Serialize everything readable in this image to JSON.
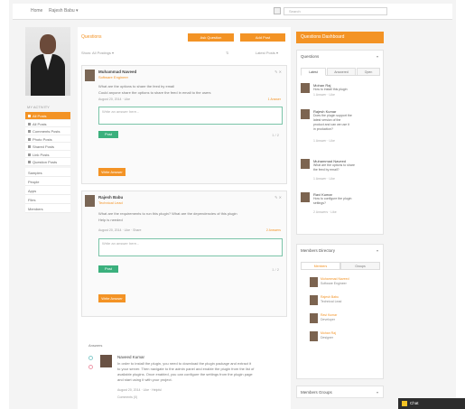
{
  "topbar": {
    "home_link": "Home",
    "user_menu": "Rajesh Babu ▾",
    "search_placeholder": "Search"
  },
  "profile": {
    "section_label": "MY ACTIVITY"
  },
  "nav": {
    "items": [
      {
        "label": "All Posts",
        "active": true
      },
      {
        "label": "All Posts",
        "active": false
      },
      {
        "label": "Comments Posts",
        "active": false
      },
      {
        "label": "Photo Posts",
        "active": false
      },
      {
        "label": "Shared Posts",
        "active": false
      },
      {
        "label": "Link Posts",
        "active": false
      },
      {
        "label": "Question Posts",
        "active": false
      }
    ],
    "secondary": [
      "Samples",
      "People",
      "Apps",
      "Files",
      "Members"
    ]
  },
  "feed": {
    "title": "Questions",
    "ask_button": "Ask Question",
    "post_button": "Add Post",
    "filter_label": "Show: All Postings ▾",
    "filter_right": "Latest Posts ▾",
    "posts": [
      {
        "author": "Muhammad Naveed",
        "subtitle": "Software Engineer",
        "line1": "What are the options to share the feed by email",
        "line2": "Could anyone share the options to share the feed in email to the users",
        "meta": "August 20, 2014 · Like",
        "right_link": "1 Answer",
        "comment_placeholder": "Write an answer here...",
        "share_label": "Post",
        "count": "1 / 2",
        "answer_button": "Write Answer"
      },
      {
        "author": "Rajesh Babu",
        "subtitle": "Technical Lead",
        "line1": "What are the requirements to run this plugin? What are the dependencies of this plugin",
        "line2": "Help is needed",
        "meta": "August 20, 2014 · Like · Share",
        "right_link": "2 Answers",
        "comment_placeholder": "Write an answer here...",
        "share_label": "Post",
        "count": "1 / 2",
        "answer_button": "Write Answer"
      }
    ],
    "answers": {
      "label": "Answers",
      "author": "Naveed Kumar",
      "lines": [
        "In order to install the plugin, you need to download the plugin package and extract it",
        "to your server. Then navigate to the admin panel and enable the plugin from the list of",
        "available plugins. Once enabled, you can configure the settings from the plugin page",
        "and start using it with your project."
      ],
      "meta": "August 20, 2014 · Like · Helpful",
      "comments": "Comments (0)"
    }
  },
  "sidebar": {
    "header": "Questions Dashboard",
    "questions_panel": {
      "title": "Questions",
      "tabs": [
        "Latest",
        "Answered",
        "Open"
      ],
      "items": [
        {
          "name": "Mohan Raj",
          "lines": [
            "How to install this plugin"
          ],
          "meta": "1 Answer · Like"
        },
        {
          "name": "Rajesh Kumar",
          "lines": [
            "Does the plugin support the",
            "latest version of the",
            "product and can we use it",
            "in production?"
          ],
          "meta": "1 Answer · Like"
        },
        {
          "name": "Muhammad Naveed",
          "lines": [
            "What are the options to share",
            "the feed by email?"
          ],
          "meta": "1 Answer · Like"
        },
        {
          "name": "Ravi Kumar",
          "lines": [
            "How to configure the plugin",
            "settings?"
          ],
          "meta": "2 Answers · Like"
        }
      ]
    },
    "members_panel": {
      "title": "Members Directory",
      "tabs": [
        "Members",
        "Groups"
      ],
      "items": [
        {
          "name": "Muhammad Naveed",
          "role": "Software Engineer"
        },
        {
          "name": "Rajesh Babu",
          "role": "Technical Lead"
        },
        {
          "name": "Ravi Kumar",
          "role": "Developer"
        },
        {
          "name": "Mohan Raj",
          "role": "Designer"
        }
      ]
    },
    "bottom_panel": {
      "title": "Members Groups"
    }
  },
  "chat": {
    "label": "Chat"
  }
}
